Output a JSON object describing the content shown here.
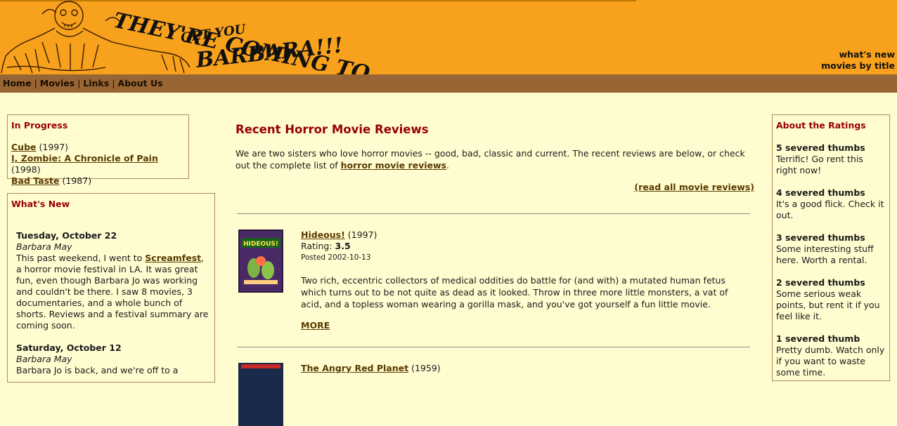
{
  "header": {
    "banner_line1": "THEY'RE COMING TO",
    "banner_line2": "GET YOU",
    "banner_line3": "BARBARA!!!",
    "links": [
      "what's new",
      "movies by title"
    ]
  },
  "nav": {
    "items": [
      "Home",
      "Movies",
      "Links",
      "About Us"
    ]
  },
  "in_progress": {
    "title": "In Progress",
    "items": [
      {
        "title": "Cube",
        "year": "(1997)"
      },
      {
        "title": "I, Zombie: A Chronicle of Pain",
        "year": "(1998)"
      },
      {
        "title": "Bad Taste",
        "year": "(1987)"
      }
    ]
  },
  "whats_new": {
    "title": "What's New",
    "entries": [
      {
        "date": "Tuesday, October 22",
        "author": "Barbara May",
        "text_before": "This past weekend, I went to ",
        "link": "Screamfest",
        "text_after": ", a horror movie festival in LA. It was great fun, even though Barbara Jo was working and couldn't be there. I saw 8 movies, 3 documentaries, and a whole bunch of shorts. Reviews and a festival summary are coming soon."
      },
      {
        "date": "Saturday, October 12",
        "author": "Barbara May",
        "text": "Barbara Jo is back, and we're off to a"
      }
    ]
  },
  "main": {
    "title": "Recent Horror Movie Reviews",
    "intro_before": "We are two sisters who love horror movies -- good, bad, classic and current. The recent reviews are below, or check out the complete list of ",
    "intro_link": "horror movie reviews",
    "intro_after": ".",
    "read_all": "(read all movie reviews)",
    "reviews": [
      {
        "title": "Hideous!",
        "year": "(1997)",
        "rating_label": "Rating: ",
        "rating": "3.5",
        "posted": "Posted 2002-10-13",
        "body": "Two rich, eccentric collectors of medical oddities do battle for (and with) a mutated human fetus which turns out to be not quite as dead as it looked. Throw in three more little monsters, a vat of acid, and a topless woman wearing a gorilla mask, and you've got yourself a fun little movie.",
        "more": "MORE",
        "poster_title": "HIDEOUS!"
      },
      {
        "title": "The Angry Red Planet",
        "year": "(1959)"
      }
    ]
  },
  "ratings": {
    "title": "About the Ratings",
    "items": [
      {
        "label": "5 severed thumbs",
        "text": "Terrific! Go rent this right now!"
      },
      {
        "label": "4 severed thumbs",
        "text": "It's a good flick. Check it out."
      },
      {
        "label": "3 severed thumbs",
        "text": "Some interesting stuff here. Worth a rental."
      },
      {
        "label": "2 severed thumbs",
        "text": "Some serious weak points, but rent it if you feel like it."
      },
      {
        "label": "1 severed thumb",
        "text": "Pretty dumb. Watch only if you want to waste some time."
      }
    ]
  },
  "colors": {
    "header_bg": "#f7a11c",
    "nav_bg": "#986534",
    "page_bg": "#fffdd0",
    "accent_red": "#990000"
  }
}
